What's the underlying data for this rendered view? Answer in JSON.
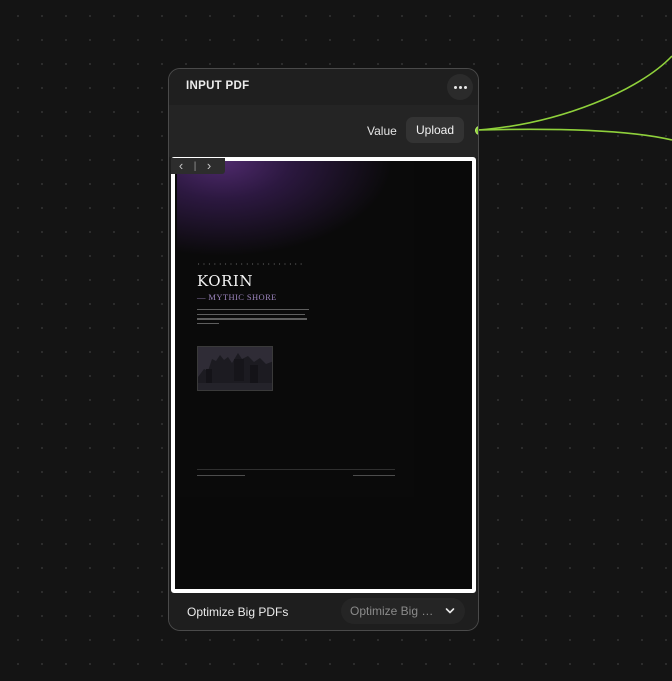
{
  "node": {
    "title": "INPUT PDF",
    "menu_icon": "more-horizontal-icon",
    "value_label": "Value",
    "upload_label": "Upload",
    "optimize_label": "Optimize Big PDFs",
    "optimize_select_value": "Optimize Big PDFs",
    "wire_color": "#8fd13b"
  },
  "preview": {
    "prev_icon": "chevron-left-icon",
    "next_icon": "chevron-right-icon",
    "document": {
      "title": "KORIN",
      "subtitle": "— MYTHIC SHORE"
    }
  }
}
